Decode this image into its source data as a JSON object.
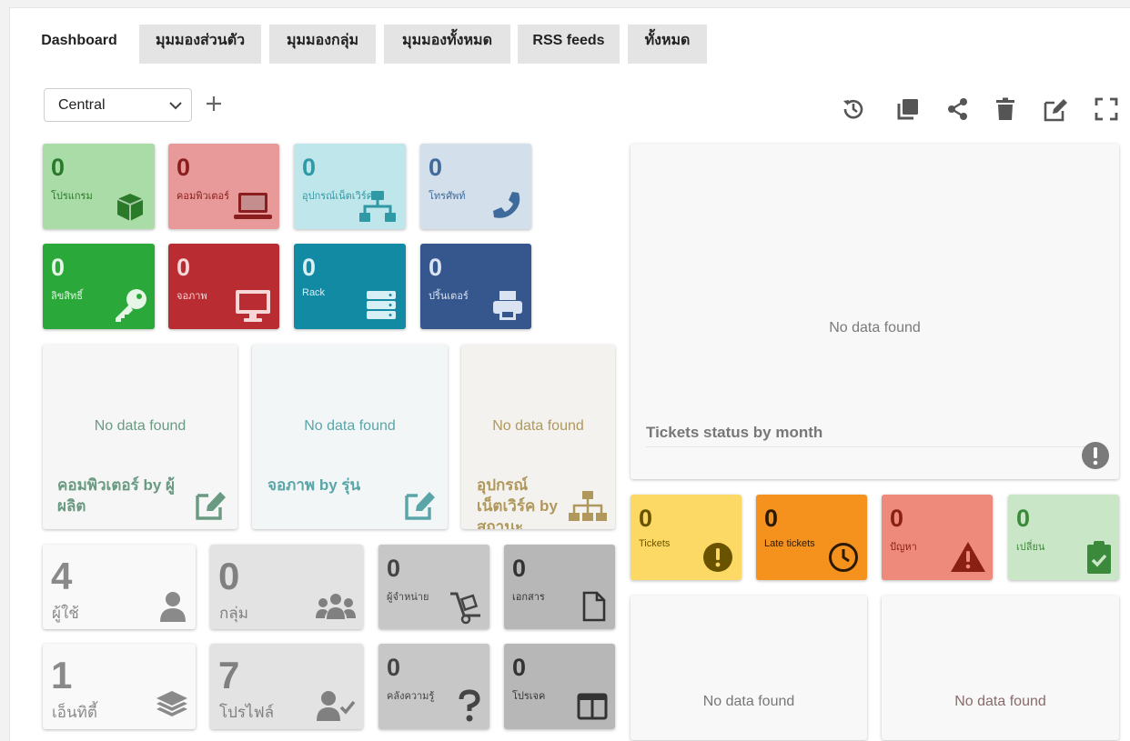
{
  "tabs": [
    {
      "label": "Dashboard"
    },
    {
      "label": "มุมมองส่วนตัว"
    },
    {
      "label": "มุมมองกลุ่ม"
    },
    {
      "label": "มุมมองทั้งหมด"
    },
    {
      "label": "RSS feeds"
    },
    {
      "label": "ทั้งหมด"
    }
  ],
  "dashboard_select": {
    "value": "Central"
  },
  "toolbar": {
    "icons": [
      "history-icon",
      "clone-icon",
      "share-icon",
      "delete-icon",
      "edit-icon",
      "fullscreen-icon"
    ]
  },
  "counters_top": [
    {
      "value": "0",
      "label": "โปรแกรม",
      "icon": "cube-icon",
      "bg": "#a9dca6",
      "fg": "#2a7a2a"
    },
    {
      "value": "0",
      "label": "คอมพิวเตอร์",
      "icon": "laptop-icon",
      "bg": "#e89a9a",
      "fg": "#8a1d1d"
    },
    {
      "value": "0",
      "label": "อุปกรณ์เน็ตเวิร์ค",
      "icon": "network-icon",
      "bg": "#bfe6ea",
      "fg": "#2f9aa6"
    },
    {
      "value": "0",
      "label": "โทรศัพท์",
      "icon": "phone-icon",
      "bg": "#d3dfea",
      "fg": "#3f6b9c"
    },
    {
      "value": "0",
      "label": "ลิขสิทธิ์",
      "icon": "key-icon",
      "bg": "#2aa83a",
      "fg": "#e6f6e6"
    },
    {
      "value": "0",
      "label": "จอภาพ",
      "icon": "monitor-icon",
      "bg": "#b82c32",
      "fg": "#f7d7d7"
    },
    {
      "value": "0",
      "label": "Rack",
      "icon": "server-icon",
      "bg": "#128aa4",
      "fg": "#d6f0f5"
    },
    {
      "value": "0",
      "label": "ปริ้นเตอร์",
      "icon": "printer-icon",
      "bg": "#35578e",
      "fg": "#d9e3f2"
    }
  ],
  "pie_widgets": [
    {
      "nodata": "No data found",
      "title": "คอมพิวเตอร์ by ผู้ผลิต",
      "icon": "edit-icon",
      "bg": "#f6f6f6",
      "fg": "#6a9a82"
    },
    {
      "nodata": "No data found",
      "title": "จอภาพ by รุ่น",
      "icon": "edit-icon",
      "bg": "#f3f6f6",
      "fg": "#5aa5a8"
    },
    {
      "nodata": "No data found",
      "title": "อุปกรณ์เน็ตเวิร์ค by สถานะ",
      "icon": "sitemap-icon",
      "bg": "#f3f2ee",
      "fg": "#b0985c"
    }
  ],
  "counters_bottom": [
    {
      "value": "4",
      "label": "ผู้ใช้",
      "icon": "user-icon",
      "bg": "#f9f9f9",
      "fg": "#8a8a8a"
    },
    {
      "value": "0",
      "label": "กลุ่ม",
      "icon": "users-icon",
      "bg": "#e3e3e3",
      "fg": "#808080"
    },
    {
      "value": "0",
      "label": "ผู้จำหน่าย",
      "icon": "dolly-icon",
      "bg": "#c7c7c7",
      "fg": "#444444"
    },
    {
      "value": "0",
      "label": "เอกสาร",
      "icon": "file-icon",
      "bg": "#b7b7b7",
      "fg": "#333333"
    },
    {
      "value": "1",
      "label": "เอ็นทิตี้",
      "icon": "layers-icon",
      "bg": "#f9f9f9",
      "fg": "#8a8a8a"
    },
    {
      "value": "7",
      "label": "โปรไฟล์",
      "icon": "user-check-icon",
      "bg": "#e3e3e3",
      "fg": "#808080"
    },
    {
      "value": "0",
      "label": "คลังความรู้",
      "icon": "question-icon",
      "bg": "#c7c7c7",
      "fg": "#444444"
    },
    {
      "value": "0",
      "label": "โปรเจค",
      "icon": "columns-icon",
      "bg": "#b7b7b7",
      "fg": "#333333"
    }
  ],
  "tickets_status": {
    "nodata": "No data found",
    "title": "Tickets status by month"
  },
  "tickets_counters": [
    {
      "value": "0",
      "label": "Tickets",
      "icon": "exclamation-circle-icon",
      "bg": "#fcd964",
      "fg": "#6a5300"
    },
    {
      "value": "0",
      "label": "Late tickets",
      "icon": "clock-icon",
      "bg": "#f5921e",
      "fg": "#2b1a00"
    },
    {
      "value": "0",
      "label": "ปัญหา",
      "icon": "warning-icon",
      "bg": "#ee8a7c",
      "fg": "#8a1f14"
    },
    {
      "value": "0",
      "label": "เปลี่ยน",
      "icon": "clipboard-check-icon",
      "bg": "#c9e7c6",
      "fg": "#3b8a3b"
    }
  ],
  "bottom_widgets": [
    {
      "nodata": "No data found"
    },
    {
      "nodata": "No data found"
    }
  ]
}
